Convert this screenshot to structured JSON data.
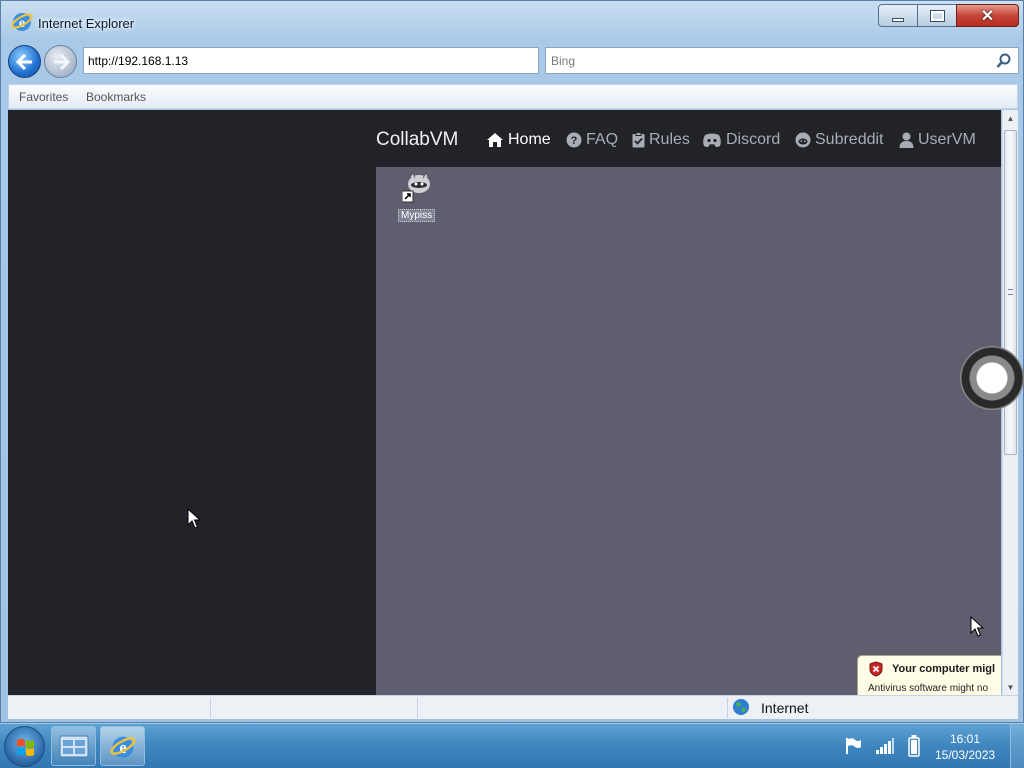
{
  "window": {
    "title": "Internet Explorer"
  },
  "nav": {
    "address": "http://192.168.1.13",
    "search_placeholder": "Bing"
  },
  "favorites_bar": {
    "items": [
      "Favorites",
      "Bookmarks"
    ]
  },
  "site": {
    "brand": "CollabVM",
    "links": [
      "Home",
      "FAQ",
      "Rules",
      "Discord",
      "Subreddit",
      "UserVM"
    ],
    "active_link": "Home"
  },
  "vm": {
    "desktop_icon_label": "Mypiss",
    "popup_title": "Your computer migl",
    "popup_body": "Antivirus software might no"
  },
  "statusbar": {
    "zone": "Internet"
  },
  "taskbar": {
    "time": "16:01",
    "date": "15/03/2023"
  },
  "colors": {
    "page_bg": "#212329",
    "vm_bg": "#5f5e6e",
    "nav_link": "#a9adb3",
    "nav_active": "#ffffff"
  }
}
